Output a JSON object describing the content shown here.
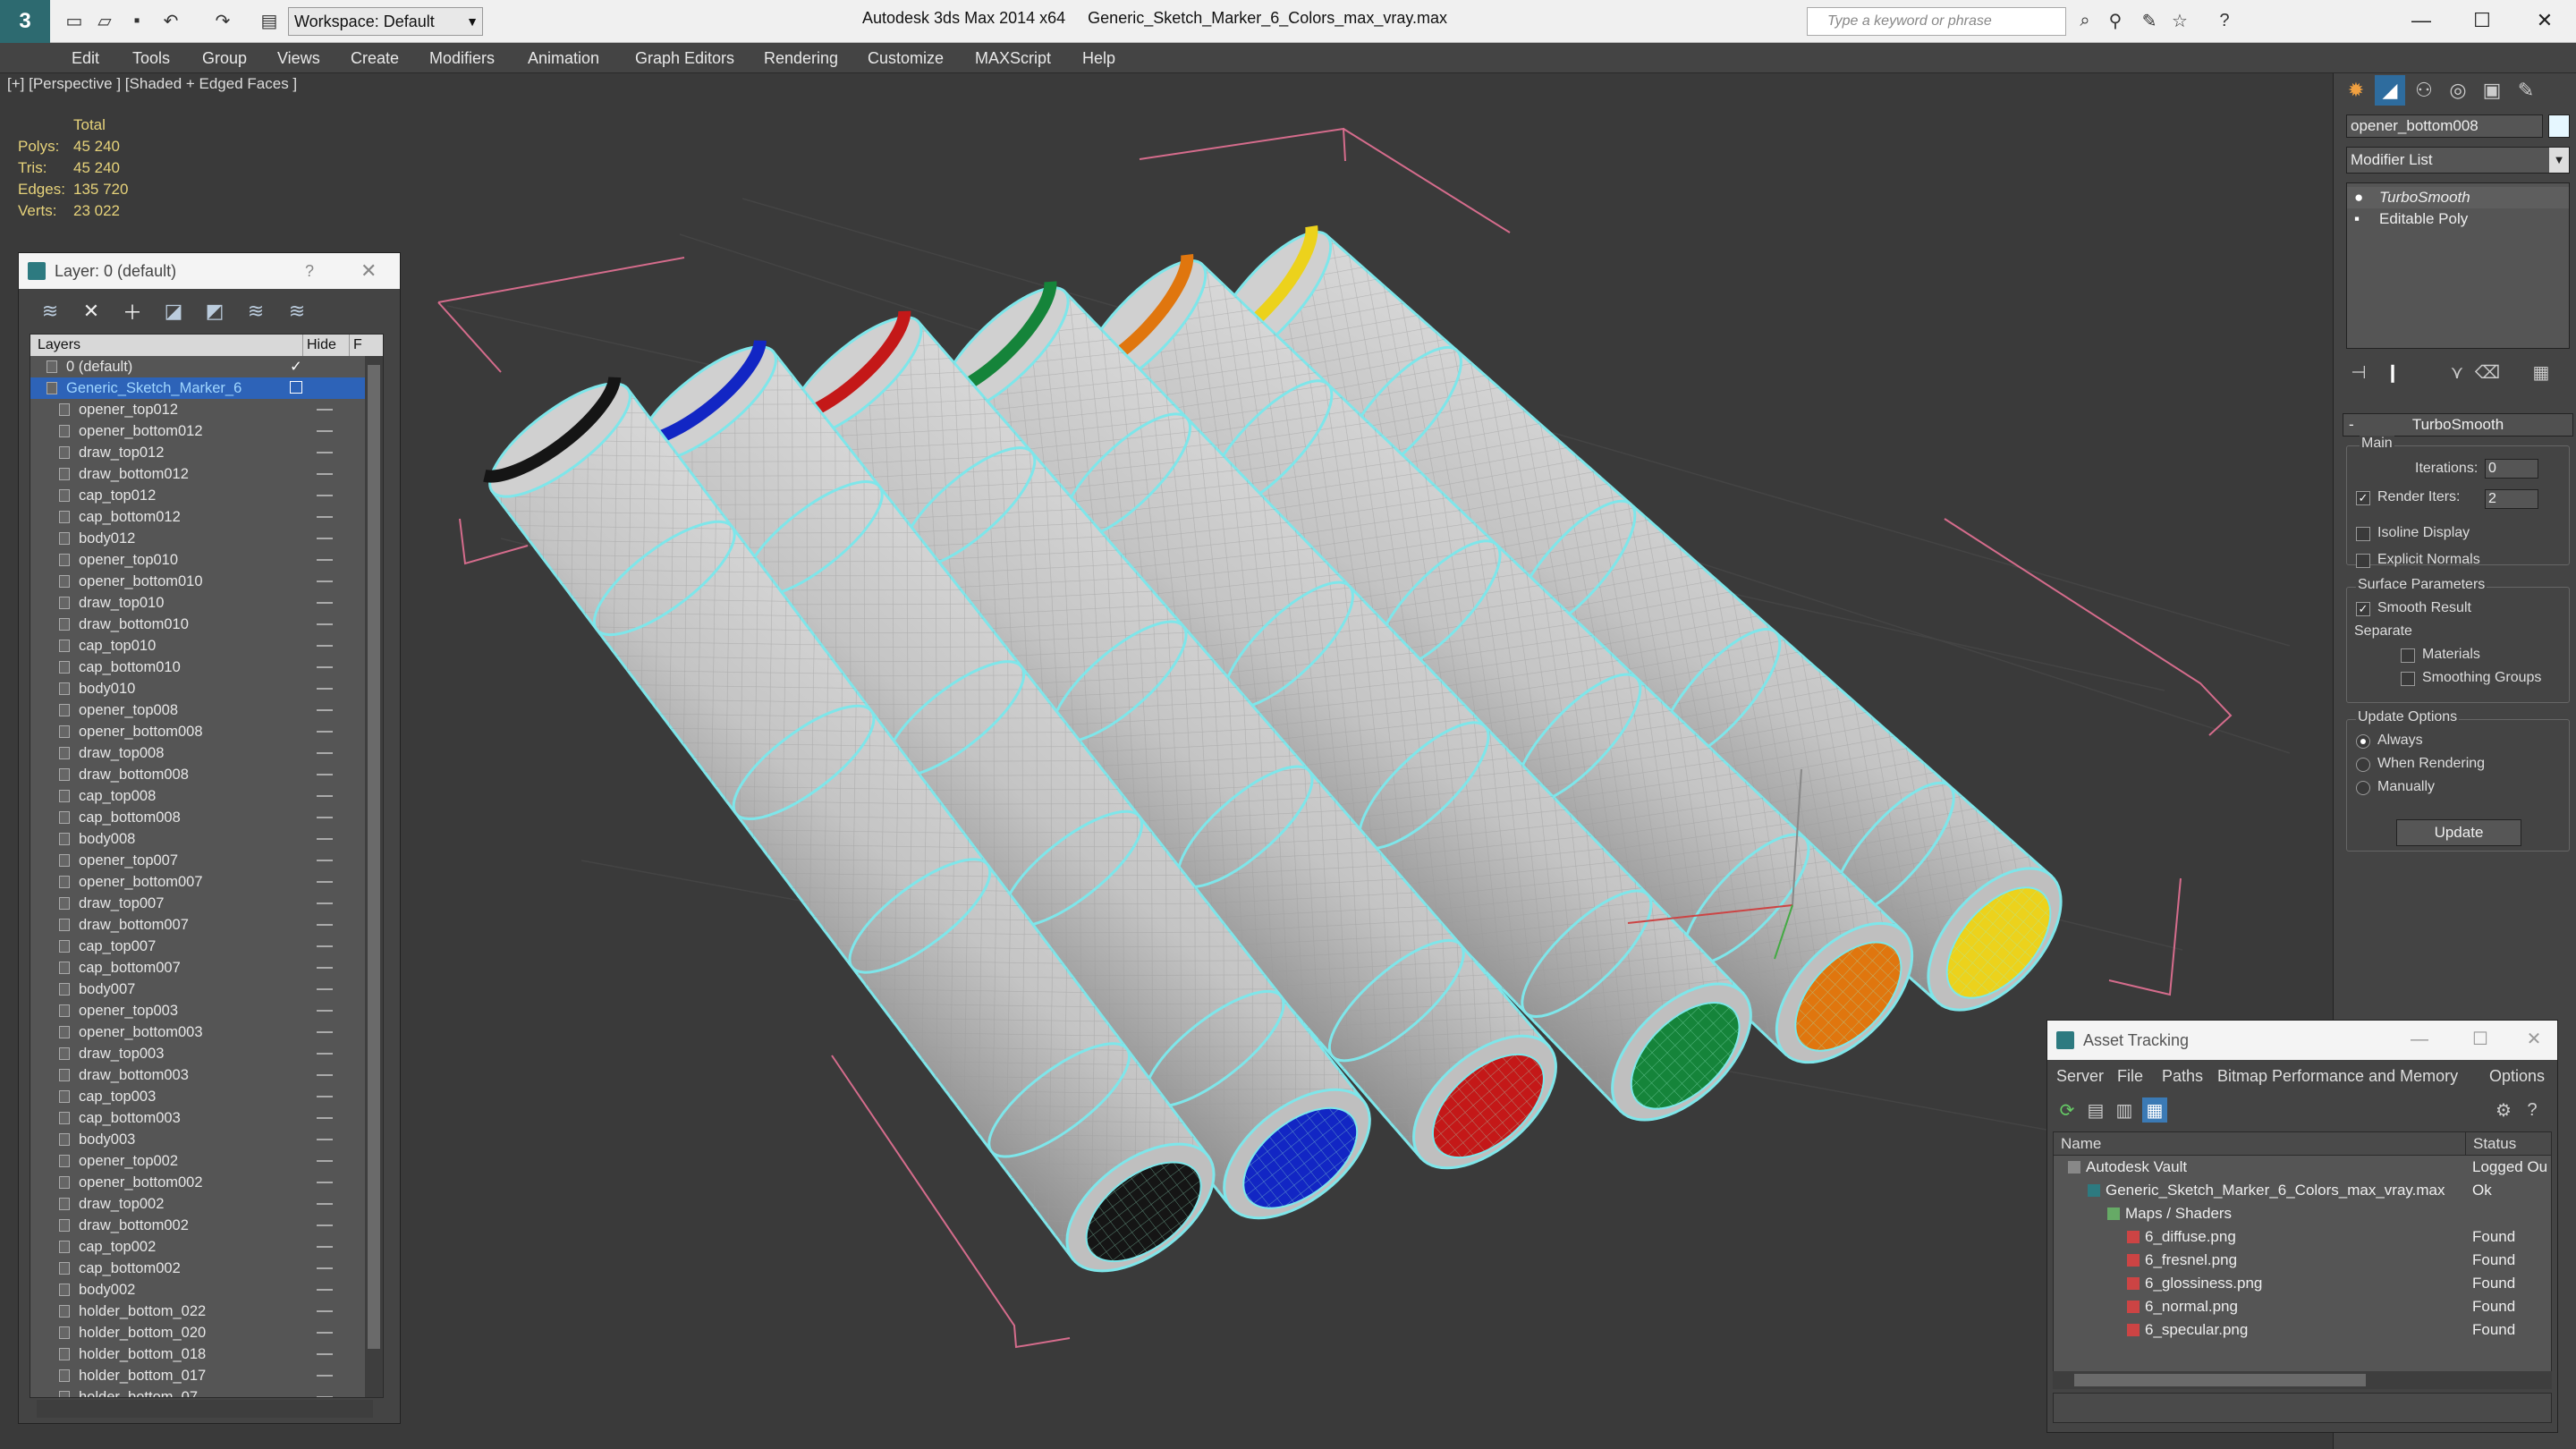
{
  "app": {
    "title": "Autodesk 3ds Max 2014 x64",
    "file": "Generic_Sketch_Marker_6_Colors_max_vray.max",
    "workspace": "Workspace: Default",
    "search_placeholder": "Type a keyword or phrase"
  },
  "menu": [
    "Edit",
    "Tools",
    "Group",
    "Views",
    "Create",
    "Modifiers",
    "Animation",
    "Graph Editors",
    "Rendering",
    "Customize",
    "MAXScript",
    "Help"
  ],
  "viewport": {
    "label": "[+] [Perspective ] [Shaded + Edged Faces ]",
    "stats": {
      "header": "Total",
      "rows": [
        {
          "k": "Polys:",
          "v": "45 240"
        },
        {
          "k": "Tris:",
          "v": "45 240"
        },
        {
          "k": "Edges:",
          "v": "135 720"
        },
        {
          "k": "Verts:",
          "v": "23 022"
        }
      ]
    },
    "marker_colors": [
      "#151515",
      "#1226c4",
      "#c41818",
      "#15843a",
      "#e0760e",
      "#ecd21c"
    ]
  },
  "layer_panel": {
    "title": "Layer: 0 (default)",
    "help": "?",
    "columns": {
      "layers": "Layers",
      "hide": "Hide",
      "freeze": "F"
    },
    "items": [
      {
        "name": "0 (default)",
        "level": 0,
        "type": "layer",
        "check": true
      },
      {
        "name": "Generic_Sketch_Marker_6",
        "level": 0,
        "type": "layer",
        "selected": true
      },
      {
        "name": "opener_top012",
        "level": 1
      },
      {
        "name": "opener_bottom012",
        "level": 1
      },
      {
        "name": "draw_top012",
        "level": 1
      },
      {
        "name": "draw_bottom012",
        "level": 1
      },
      {
        "name": "cap_top012",
        "level": 1
      },
      {
        "name": "cap_bottom012",
        "level": 1
      },
      {
        "name": "body012",
        "level": 1
      },
      {
        "name": "opener_top010",
        "level": 1
      },
      {
        "name": "opener_bottom010",
        "level": 1
      },
      {
        "name": "draw_top010",
        "level": 1
      },
      {
        "name": "draw_bottom010",
        "level": 1
      },
      {
        "name": "cap_top010",
        "level": 1
      },
      {
        "name": "cap_bottom010",
        "level": 1
      },
      {
        "name": "body010",
        "level": 1
      },
      {
        "name": "opener_top008",
        "level": 1
      },
      {
        "name": "opener_bottom008",
        "level": 1
      },
      {
        "name": "draw_top008",
        "level": 1
      },
      {
        "name": "draw_bottom008",
        "level": 1
      },
      {
        "name": "cap_top008",
        "level": 1
      },
      {
        "name": "cap_bottom008",
        "level": 1
      },
      {
        "name": "body008",
        "level": 1
      },
      {
        "name": "opener_top007",
        "level": 1
      },
      {
        "name": "opener_bottom007",
        "level": 1
      },
      {
        "name": "draw_top007",
        "level": 1
      },
      {
        "name": "draw_bottom007",
        "level": 1
      },
      {
        "name": "cap_top007",
        "level": 1
      },
      {
        "name": "cap_bottom007",
        "level": 1
      },
      {
        "name": "body007",
        "level": 1
      },
      {
        "name": "opener_top003",
        "level": 1
      },
      {
        "name": "opener_bottom003",
        "level": 1
      },
      {
        "name": "draw_top003",
        "level": 1
      },
      {
        "name": "draw_bottom003",
        "level": 1
      },
      {
        "name": "cap_top003",
        "level": 1
      },
      {
        "name": "cap_bottom003",
        "level": 1
      },
      {
        "name": "body003",
        "level": 1
      },
      {
        "name": "opener_top002",
        "level": 1
      },
      {
        "name": "opener_bottom002",
        "level": 1
      },
      {
        "name": "draw_top002",
        "level": 1
      },
      {
        "name": "draw_bottom002",
        "level": 1
      },
      {
        "name": "cap_top002",
        "level": 1
      },
      {
        "name": "cap_bottom002",
        "level": 1
      },
      {
        "name": "body002",
        "level": 1
      },
      {
        "name": "holder_bottom_022",
        "level": 1
      },
      {
        "name": "holder_bottom_020",
        "level": 1
      },
      {
        "name": "holder_bottom_018",
        "level": 1
      },
      {
        "name": "holder_bottom_017",
        "level": 1
      },
      {
        "name": "holder_bottom_07",
        "level": 1
      }
    ]
  },
  "command_panel": {
    "object_name": "opener_bottom008",
    "modifier_list": "Modifier List",
    "stack": [
      "TurboSmooth",
      "Editable Poly"
    ],
    "turbosmooth": {
      "title": "TurboSmooth",
      "main_label": "Main",
      "iterations_label": "Iterations:",
      "iterations": "0",
      "render_iters_label": "Render Iters:",
      "render_iters": "2",
      "isoline": "Isoline Display",
      "explicit": "Explicit Normals",
      "surface_label": "Surface Parameters",
      "smooth_result": "Smooth Result",
      "separate": "Separate",
      "materials": "Materials",
      "smoothing_groups": "Smoothing Groups",
      "update_options": "Update Options",
      "always": "Always",
      "when_rendering": "When Rendering",
      "manually": "Manually",
      "update": "Update"
    }
  },
  "asset_tracking": {
    "title": "Asset Tracking",
    "menu": [
      "Server",
      "File",
      "Paths",
      "Bitmap Performance and Memory",
      "Options"
    ],
    "columns": {
      "name": "Name",
      "status": "Status"
    },
    "rows": [
      {
        "name": "Autodesk Vault",
        "status": "Logged Ou",
        "level": 0
      },
      {
        "name": "Generic_Sketch_Marker_6_Colors_max_vray.max",
        "status": "Ok",
        "level": 1
      },
      {
        "name": "Maps / Shaders",
        "status": "",
        "level": 2
      },
      {
        "name": "6_diffuse.png",
        "status": "Found",
        "level": 3
      },
      {
        "name": "6_fresnel.png",
        "status": "Found",
        "level": 3
      },
      {
        "name": "6_glossiness.png",
        "status": "Found",
        "level": 3
      },
      {
        "name": "6_normal.png",
        "status": "Found",
        "level": 3
      },
      {
        "name": "6_specular.png",
        "status": "Found",
        "level": 3
      }
    ]
  }
}
